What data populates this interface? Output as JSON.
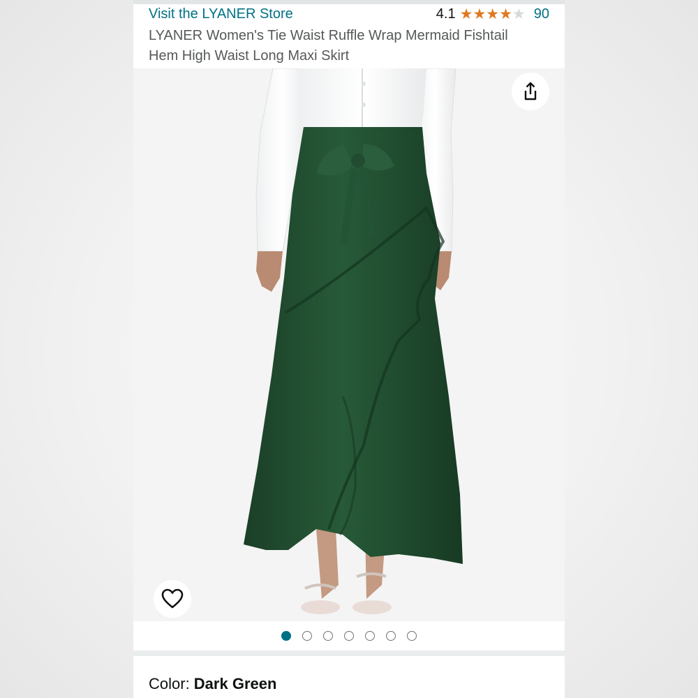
{
  "header": {
    "store_link": "Visit the LYANER Store",
    "rating_value": "4.1",
    "rating_stars": 4.1,
    "rating_count": "90",
    "title": "LYANER Women's Tie Waist Ruffle Wrap Mermaid Fishtail Hem High Waist Long Maxi Skirt"
  },
  "gallery": {
    "image_count": 7,
    "active_index": 0
  },
  "color": {
    "label": "Color:",
    "value": "Dark Green"
  },
  "icons": {
    "share": "share-icon",
    "wishlist": "heart-icon",
    "star": "star-icon"
  },
  "colors": {
    "link": "#007185",
    "star": "#de7921",
    "skirt": "#1f4a2e",
    "active_dot": "#007185"
  }
}
